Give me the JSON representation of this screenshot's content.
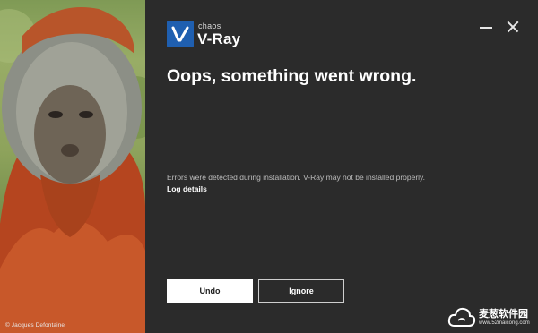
{
  "photo": {
    "credit": "© Jacques Defontaine"
  },
  "brand": {
    "company": "chaos",
    "product": "V-Ray"
  },
  "window_controls": {
    "minimize_icon": "minimize-icon",
    "close_icon": "close-icon"
  },
  "dialog": {
    "title": "Oops, something went wrong.",
    "message": "Errors were detected during installation. V-Ray may not be installed properly.",
    "log_link": "Log details"
  },
  "buttons": {
    "undo": "Undo",
    "ignore": "Ignore"
  },
  "watermark": {
    "name": "麦葱软件园",
    "url": "www.52maicong.com",
    "icon": "cloud-icon"
  },
  "colors": {
    "background": "#2b2b2b",
    "logo_blue": "#1f5fb0",
    "text": "#ffffff",
    "muted_text": "#bdbdbd"
  }
}
